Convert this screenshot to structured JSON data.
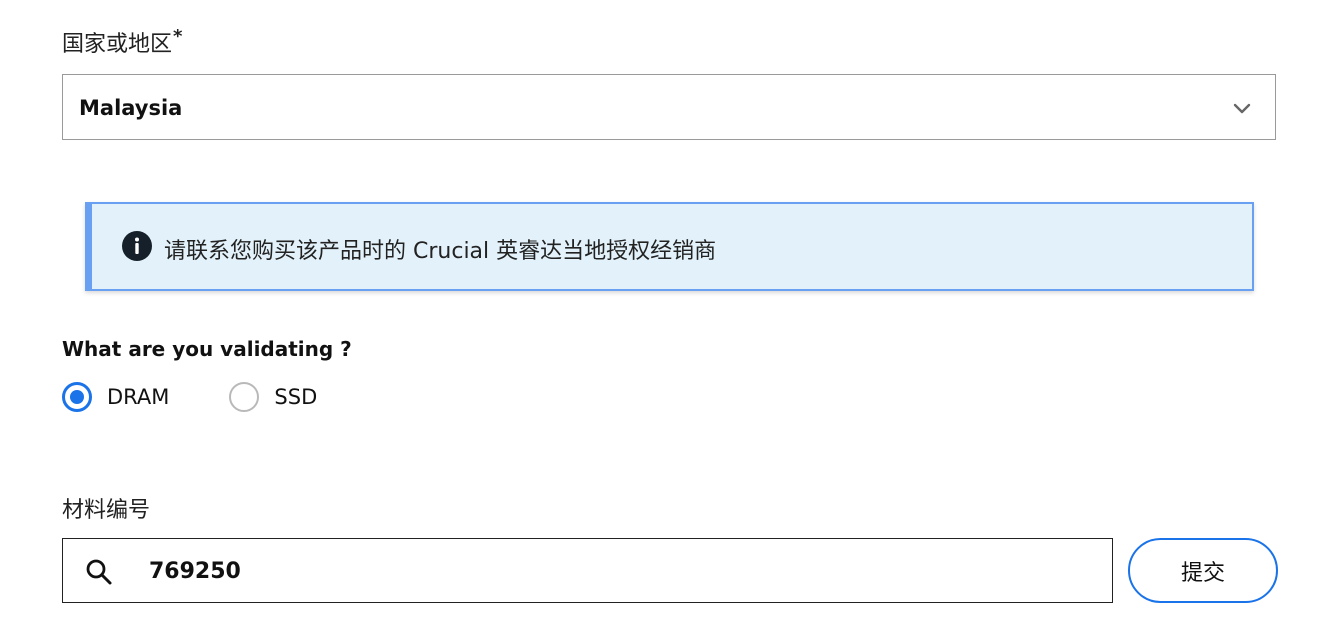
{
  "country_field": {
    "label": "国家或地区",
    "required_marker": "*",
    "selected_value": "Malaysia",
    "icon": "chevron-down-icon"
  },
  "info_banner": {
    "icon": "info-icon",
    "text": "请联系您购买该产品时的 Crucial 英睿达当地授权经销商",
    "accent_color": "#6aa0f2",
    "background_color": "#e3f2fa"
  },
  "validation": {
    "question": "What are you validating ?",
    "options": [
      {
        "label": "DRAM",
        "checked": true
      },
      {
        "label": "SSD",
        "checked": false
      }
    ],
    "accent_color": "#1a73e8"
  },
  "part_number": {
    "label": "材料编号",
    "value": "769250",
    "icon": "search-icon"
  },
  "submit": {
    "label": "提交"
  }
}
